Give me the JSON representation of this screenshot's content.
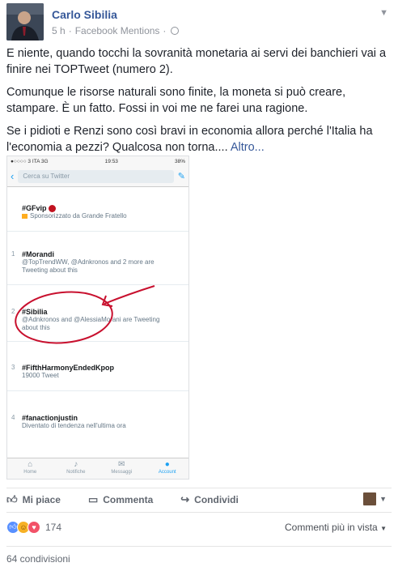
{
  "post": {
    "author": "Carlo Sibilia",
    "time": "5 h",
    "separator": "·",
    "app": "Facebook Mentions",
    "separator2": "·",
    "paragraphs": [
      "E niente, quando tocchi la sovranità monetaria ai servi dei banchieri vai a finire nei TOPTweet (numero 2).",
      "Comunque le risorse naturali sono finite, la moneta si può creare, stampare. È un fatto. Fossi in voi me ne farei una ragione.",
      "Se i pidioti e Renzi sono così bravi in economia allora perché l'Italia ha l'economia a pezzi? Qualcosa non torna...."
    ],
    "more": "Altro..."
  },
  "screenshot": {
    "carrier": "●○○○○ 3 ITA  3G",
    "clock": "19:53",
    "battery": "38%",
    "search_placeholder": "Cerca su Twitter",
    "trends": [
      {
        "num": "",
        "tag": "#GFvip",
        "sub": "Sponsorizzato da Grande Fratello"
      },
      {
        "num": "1",
        "tag": "#Morandi",
        "sub": "@TopTrendWW, @Adnkronos and 2 more are Tweeting about this"
      },
      {
        "num": "2",
        "tag": "#Sibilia",
        "sub": "@Adnkronos and @AlessiaMorani are Tweeting about this"
      },
      {
        "num": "3",
        "tag": "#FifthHarmonyEndedKpop",
        "sub": "19000 Tweet"
      },
      {
        "num": "4",
        "tag": "#fanactionjustin",
        "sub": "Diventato di tendenza nell'ultima ora"
      }
    ],
    "tabs": [
      {
        "label": "Home",
        "icon": "home-icon"
      },
      {
        "label": "Notifiche",
        "icon": "bell-icon"
      },
      {
        "label": "Messaggi",
        "icon": "mail-icon"
      },
      {
        "label": "Account",
        "icon": "person-icon"
      }
    ]
  },
  "actions": {
    "like": "Mi piace",
    "comment": "Commenta",
    "share": "Condividi"
  },
  "reactions": {
    "count": "174",
    "comments_order": "Commenti più in vista"
  },
  "shares": "64 condivisioni"
}
